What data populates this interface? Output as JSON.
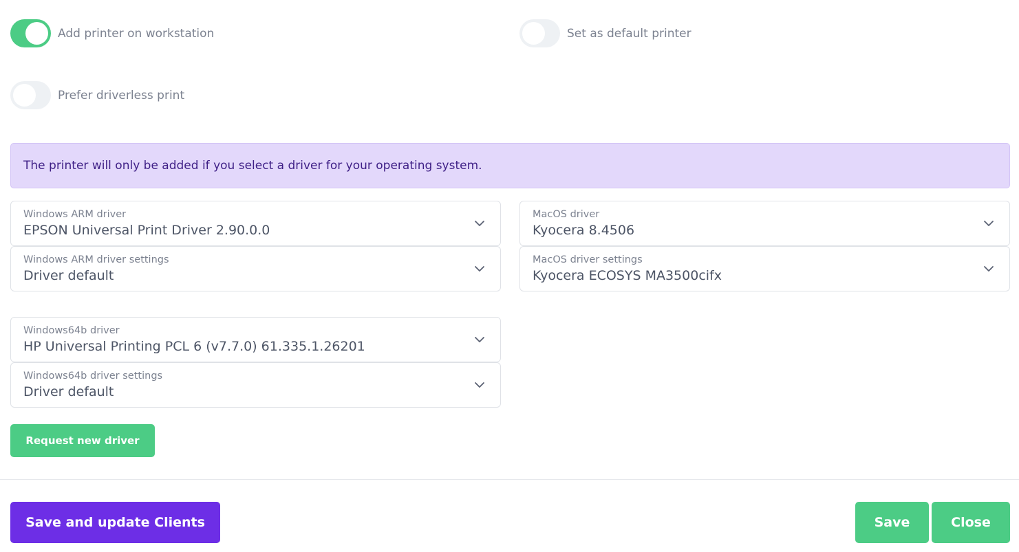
{
  "toggles": {
    "add_printer": {
      "label": "Add printer on workstation",
      "on": true
    },
    "default_printer": {
      "label": "Set as default printer",
      "on": false
    },
    "driverless": {
      "label": "Prefer driverless print",
      "on": false
    }
  },
  "banner": {
    "text": "The printer will only be added if you select a driver for your operating system."
  },
  "fields": {
    "win_arm_driver": {
      "label": "Windows ARM driver",
      "value": "EPSON Universal Print Driver 2.90.0.0"
    },
    "win_arm_settings": {
      "label": "Windows ARM driver settings",
      "value": "Driver default"
    },
    "mac_driver": {
      "label": "MacOS driver",
      "value": "Kyocera 8.4506"
    },
    "mac_settings": {
      "label": "MacOS driver settings",
      "value": "Kyocera ECOSYS MA3500cifx"
    },
    "win64_driver": {
      "label": "Windows64b driver",
      "value": "HP Universal Printing PCL 6 (v7.7.0) 61.335.1.26201"
    },
    "win64_settings": {
      "label": "Windows64b driver settings",
      "value": "Driver default"
    }
  },
  "buttons": {
    "request_driver": "Request new driver",
    "save_update": "Save and update Clients",
    "save": "Save",
    "close": "Close"
  },
  "colors": {
    "accent_green": "#4ccc85",
    "accent_purple": "#6d2ee6",
    "banner_bg": "#e3d8fb",
    "banner_text": "#3e1f86"
  },
  "icons": {
    "select_chevron": "chevron-down-icon"
  }
}
